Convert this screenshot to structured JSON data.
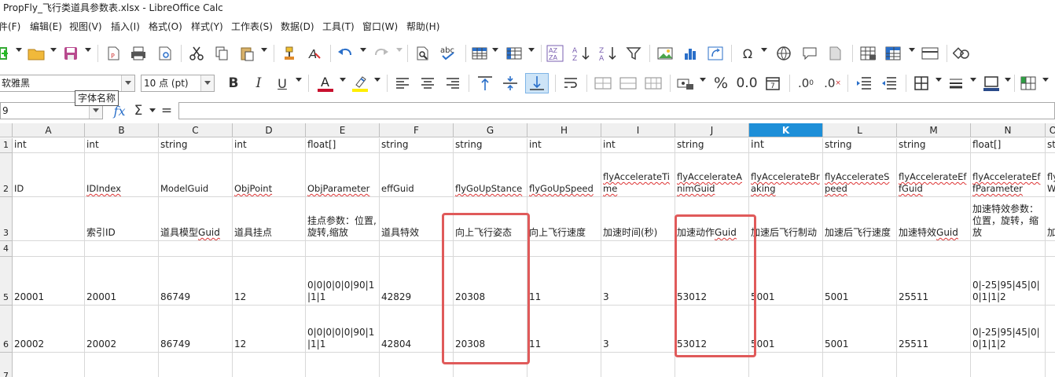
{
  "window": {
    "title": "PropFly_飞行类道具参数表.xlsx - LibreOffice Calc"
  },
  "menu": [
    "件(F)",
    "编辑(E)",
    "视图(V)",
    "插入(I)",
    "格式(O)",
    "样式(Y)",
    "工作表(S)",
    "数据(D)",
    "工具(T)",
    "窗口(W)",
    "帮助(H)"
  ],
  "format": {
    "font_name": "软雅黑",
    "font_size": "10 点 (pt)",
    "tooltip": "字体名称"
  },
  "formula": {
    "name_box": "9",
    "sigma": "Σ",
    "equals": "=",
    "fx": "fx"
  },
  "columns": [
    "A",
    "B",
    "C",
    "D",
    "E",
    "F",
    "G",
    "H",
    "I",
    "J",
    "K",
    "L",
    "M",
    "N",
    "O"
  ],
  "selected_column": "K",
  "row_numbers": [
    "1",
    "2",
    "3",
    "4",
    "5",
    "6",
    "7"
  ],
  "rows": [
    [
      "int",
      "int",
      "string",
      "int",
      "float[]",
      "string",
      "string",
      "int",
      "int",
      "string",
      "int",
      "string",
      "string",
      "float[]",
      "st"
    ],
    [
      "ID",
      "IDIndex",
      "ModelGuid",
      "ObjPoint",
      "ObjParameter",
      "effGuid",
      "flyGoUpStance",
      "flyGoUpSpeed",
      "flyAccelerateTime",
      "flyAccelerateAnimGuid",
      "flyAccelerateBraking",
      "flyAccelerateSpeed",
      "flyAccelerateEffGuid",
      "flyAccelerateEffParameter",
      "fly W"
    ],
    [
      "",
      "索引ID",
      "道具模型Guid",
      "道具挂点",
      "挂点参数：位置,旋转,缩放",
      "道具特效",
      "向上飞行姿态",
      "向上飞行速度",
      "加速时间(秒)",
      "加速动作Guid",
      "加速后飞行制动",
      "加速后飞行速度",
      "加速特效Guid",
      "加速特效参数：位置，旋转，缩放",
      "加"
    ],
    [
      "",
      "",
      "",
      "",
      "",
      "",
      "",
      "",
      "",
      "",
      "",
      "",
      "",
      "",
      ""
    ],
    [
      "20001",
      "20001",
      "86749",
      "12",
      "0|0|0|0|0|90|1|1|1",
      "42829",
      "20308",
      "11",
      "3",
      "53012",
      "5001",
      "5001",
      "25511",
      "0|-25|95|45|0|0|1|1|2",
      ""
    ],
    [
      "20002",
      "20002",
      "86749",
      "12",
      "0|0|0|0|0|90|1|1|1",
      "42804",
      "20308",
      "11",
      "3",
      "53012",
      "5001",
      "5001",
      "25511",
      "0|-25|95|45|0|0|1|1|2",
      ""
    ],
    [
      "",
      "",
      "",
      "",
      "",
      "",
      "",
      "",
      "",
      "",
      "",
      "",
      "",
      "",
      ""
    ]
  ],
  "accent_color": "#1e8fd8",
  "highlight_color": "#e05a5a"
}
